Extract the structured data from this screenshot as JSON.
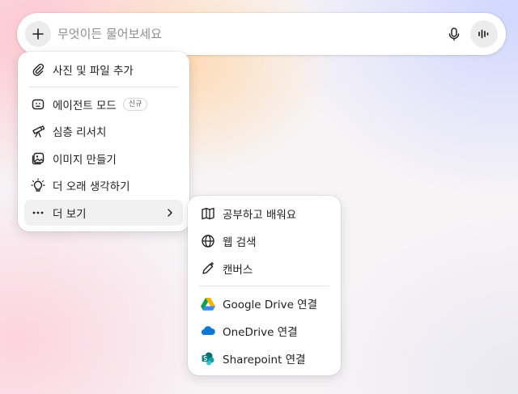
{
  "search": {
    "placeholder": "무엇이든 물어보세요",
    "plus_icon": "plus-icon",
    "mic_icon": "mic-icon",
    "voice_icon": "voice-waveform-icon"
  },
  "attach_menu": {
    "items": [
      {
        "label": "사진 및 파일 추가",
        "icon": "paperclip-icon"
      },
      {
        "label": "에이전트 모드",
        "icon": "agent-icon",
        "badge": "신규"
      },
      {
        "label": "심층 리서치",
        "icon": "telescope-icon"
      },
      {
        "label": "이미지 만들기",
        "icon": "image-icon"
      },
      {
        "label": "더 오래 생각하기",
        "icon": "lightbulb-icon"
      },
      {
        "label": "더 보기",
        "icon": "more-dots-icon",
        "submenu_icon": "chevron-right-icon"
      }
    ]
  },
  "more_menu": {
    "items": [
      {
        "label": "공부하고 배워요",
        "icon": "book-icon"
      },
      {
        "label": "웹 검색",
        "icon": "globe-icon"
      },
      {
        "label": "캔버스",
        "icon": "pen-sparkle-icon"
      },
      {
        "label": "Google Drive 연결",
        "icon": "google-drive-icon"
      },
      {
        "label": "OneDrive 연결",
        "icon": "onedrive-icon"
      },
      {
        "label": "Sharepoint 연결",
        "icon": "sharepoint-icon"
      }
    ]
  },
  "colors": {
    "gdrive_green": "#0F9D58",
    "gdrive_yellow": "#F4B400",
    "gdrive_blue": "#4285F4",
    "onedrive_blue": "#0F78D4",
    "sharepoint_teal": "#038387"
  }
}
